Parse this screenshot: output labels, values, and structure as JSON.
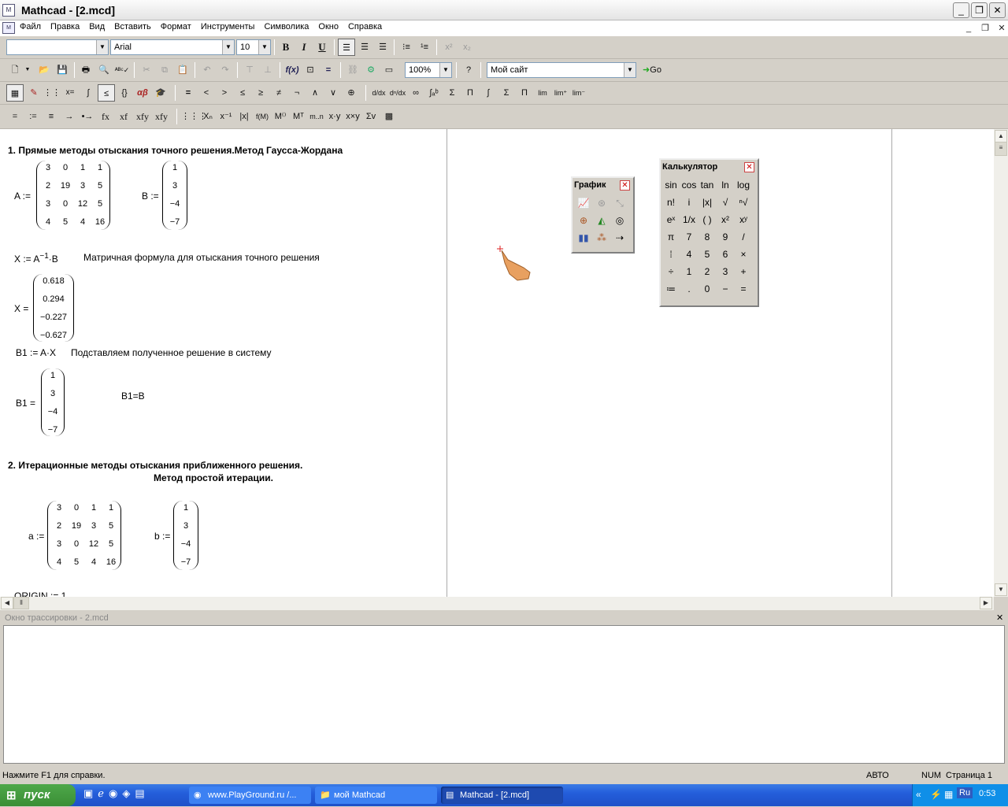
{
  "window": {
    "title": "Mathcad - [2.mcd]",
    "app_icon": "mathcad-icon"
  },
  "menu": [
    "Файл",
    "Правка",
    "Вид",
    "Вставить",
    "Формат",
    "Инструменты",
    "Символика",
    "Окно",
    "Справка"
  ],
  "format_toolbar": {
    "style_value": "",
    "font_value": "Arial",
    "size_value": "10",
    "bold": "B",
    "italic": "I",
    "underline": "U"
  },
  "standard_toolbar": {
    "zoom_value": "100%",
    "resource_value": "Мой сайт",
    "go_label": "Go"
  },
  "math_toolbar": {
    "operators": [
      "=",
      "<",
      ">",
      "≤",
      "≥",
      "≠",
      "¬",
      "∧",
      "∨",
      "⊕"
    ]
  },
  "eval_toolbar": {
    "items": [
      "=",
      ":=",
      "≡",
      "→",
      "•→",
      "fx",
      "xf",
      "xfy",
      "xfy"
    ]
  },
  "doc": {
    "heading1": "1. Прямые методы отыскания точного решения.Метод Гаусса-Жордана",
    "A_label": "A :=",
    "A_matrix": [
      [
        "3",
        "0",
        "1",
        "1"
      ],
      [
        "2",
        "19",
        "3",
        "5"
      ],
      [
        "3",
        "0",
        "12",
        "5"
      ],
      [
        "4",
        "5",
        "4",
        "16"
      ]
    ],
    "B_label": "B :=",
    "B_vector": [
      "1",
      "3",
      "−4",
      "−7"
    ],
    "x_formula": "X := A",
    "x_formula_exp": "−1",
    "x_formula_tail": "·B",
    "x_comment": "Матричная формула для отыскания точного решения",
    "X_label": "X =",
    "X_vector": [
      "0.618",
      "0.294",
      "−0.227",
      "−0.627"
    ],
    "b1_formula": "B1 := A·X",
    "b1_comment": "Подставляем полученное решение в систему",
    "B1_label": "B1 =",
    "B1_vector": [
      "1",
      "3",
      "−4",
      "−7"
    ],
    "b1_eq": "B1=B",
    "heading2": "2. Итерационные методы отыскания приближенного решения.",
    "heading2b": "Метод простой итерации.",
    "a_label": "a :=",
    "a_matrix": [
      [
        "3",
        "0",
        "1",
        "1"
      ],
      [
        "2",
        "19",
        "3",
        "5"
      ],
      [
        "3",
        "0",
        "12",
        "5"
      ],
      [
        "4",
        "5",
        "4",
        "16"
      ]
    ],
    "b_label": "b :=",
    "b_vector": [
      "1",
      "3",
      "−4",
      "−7"
    ],
    "origin_partial": "ORIGIN := 1"
  },
  "graph_palette": {
    "title": "График"
  },
  "calc_palette": {
    "title": "Калькулятор",
    "rows": [
      [
        "sin",
        "cos",
        "tan",
        "ln",
        "log"
      ],
      [
        "n!",
        "i",
        "|x|",
        "√",
        "ⁿ√"
      ],
      [
        "eˣ",
        "1/x",
        "( )",
        "x²",
        "xʸ"
      ],
      [
        "π",
        "7",
        "8",
        "9",
        "/"
      ],
      [
        "⁞",
        "4",
        "5",
        "6",
        "×"
      ],
      [
        "÷",
        "1",
        "2",
        "3",
        "+"
      ],
      [
        "≔",
        ".",
        "0",
        "−",
        "="
      ]
    ]
  },
  "trace_window": {
    "title": "Окно трассировки - 2.mcd"
  },
  "status": {
    "help": "Нажмите F1 для справки.",
    "mode": "АВТО",
    "num": "NUM",
    "page": "Страница 1"
  },
  "taskbar": {
    "start": "пуск",
    "tasks": [
      "www.PlayGround.ru /...",
      "мой Mathcad",
      "Mathcad - [2.mcd]"
    ],
    "lang": "Ru",
    "clock": "0:53"
  }
}
